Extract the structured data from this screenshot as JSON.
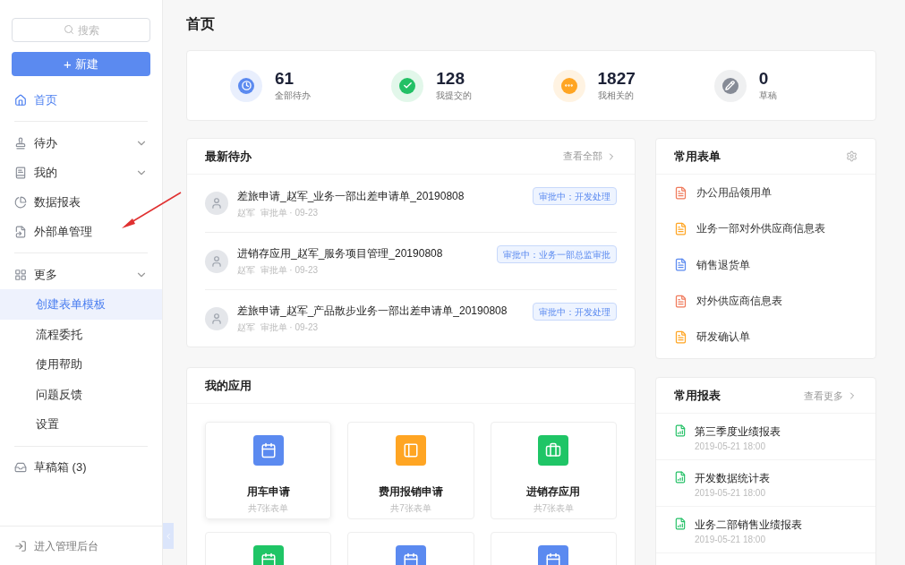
{
  "sidebar": {
    "search": {
      "placeholder": "搜索"
    },
    "new_button": {
      "icon": "+",
      "label": "新建"
    },
    "items": [
      {
        "label": "首页",
        "selected": true,
        "kind": "link"
      },
      {
        "kind": "divider"
      },
      {
        "label": "待办",
        "selected": false,
        "kind": "group"
      },
      {
        "label": "我的",
        "selected": false,
        "kind": "group"
      },
      {
        "label": "数据报表",
        "selected": false,
        "kind": "link"
      },
      {
        "label": "外部单管理",
        "selected": false,
        "kind": "link"
      },
      {
        "kind": "divider"
      },
      {
        "label": "更多",
        "selected": false,
        "kind": "group",
        "children": [
          {
            "label": "创建表单模板",
            "selected": true
          },
          {
            "label": "流程委托",
            "selected": false
          },
          {
            "label": "使用帮助",
            "selected": false
          },
          {
            "label": "问题反馈",
            "selected": false
          },
          {
            "label": "设置",
            "selected": false
          }
        ]
      },
      {
        "kind": "divider"
      },
      {
        "label": "草稿箱 (3)",
        "selected": false,
        "kind": "link"
      }
    ],
    "footer": "进入管理后台"
  },
  "page_title": "首页",
  "stats": [
    {
      "value": "61",
      "label": "全部待办",
      "color": "#5b8af0"
    },
    {
      "value": "128",
      "label": "我提交的",
      "color": "#22c065"
    },
    {
      "value": "1827",
      "label": "我相关的",
      "color": "#ffa523"
    },
    {
      "value": "0",
      "label": "草稿",
      "color": "#868b96"
    }
  ],
  "todos": {
    "title": "最新待办",
    "more": "查看全部",
    "items": [
      {
        "title": "差旅申请_赵军_业务一部出差申请单_20190808",
        "person": "赵军",
        "type": "审批单",
        "sep": "·",
        "date": "09-23",
        "status": "审批中：开发处理"
      },
      {
        "title": "进销存应用_赵军_服务项目管理_20190808",
        "person": "赵军",
        "type": "审批单",
        "sep": "·",
        "date": "09-23",
        "status": "审批中：业务一部总监审批"
      },
      {
        "title": "差旅申请_赵军_产品散步业务一部出差申请单_20190808",
        "person": "赵军",
        "type": "审批单",
        "sep": "·",
        "date": "09-23",
        "status": "审批中：开发处理"
      }
    ]
  },
  "apps": {
    "title": "我的应用",
    "items": [
      {
        "name": "用车申请",
        "count": "共7张表单",
        "color": "#5b8af0",
        "kind": "calendar"
      },
      {
        "name": "费用报销申请",
        "count": "共7张表单",
        "color": "#ffa523",
        "kind": "layout"
      },
      {
        "name": "进销存应用",
        "count": "共7张表单",
        "color": "#1fc566",
        "kind": "briefcase"
      },
      {
        "color": "#1fc566",
        "kind": "calendar"
      },
      {
        "color": "#5b8af0",
        "kind": "calendar"
      },
      {
        "color": "#5b8af0",
        "kind": "calendar"
      }
    ]
  },
  "forms": {
    "title": "常用表单",
    "items": [
      {
        "label": "办公用品领用单",
        "color": "#f0795a"
      },
      {
        "label": "业务一部对外供应商信息表",
        "color": "#ffa523"
      },
      {
        "label": "销售退货单",
        "color": "#5b8af0"
      },
      {
        "label": "对外供应商信息表",
        "color": "#f0795a"
      },
      {
        "label": "研发确认单",
        "color": "#ffa523"
      }
    ]
  },
  "reports": {
    "title": "常用报表",
    "more": "查看更多",
    "items": [
      {
        "label": "第三季度业绩报表",
        "time": "2019-05-21 18:00"
      },
      {
        "label": "开发数据统计表",
        "time": "2019-05-21 18:00"
      },
      {
        "label": "业务二部销售业绩报表",
        "time": "2019-05-21 18:00"
      }
    ]
  }
}
